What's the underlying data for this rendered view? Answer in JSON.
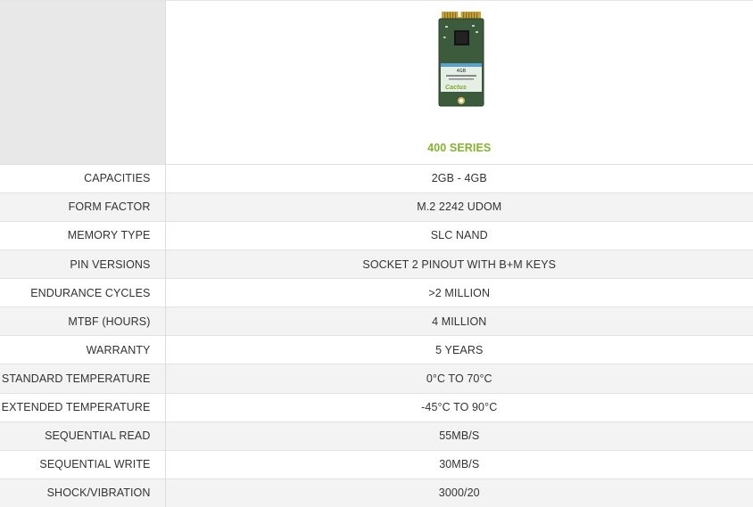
{
  "product": {
    "series_title": "400 SERIES",
    "image_label_capacity": "4GB",
    "image_brand": "Cactus"
  },
  "specs": [
    {
      "label": "CAPACITIES",
      "value": "2GB - 4GB"
    },
    {
      "label": "FORM FACTOR",
      "value": "M.2 2242 UDOM"
    },
    {
      "label": "MEMORY TYPE",
      "value": "SLC NAND"
    },
    {
      "label": "PIN VERSIONS",
      "value": "SOCKET 2 PINOUT WITH B+M KEYS"
    },
    {
      "label": "ENDURANCE CYCLES",
      "value": ">2 MILLION"
    },
    {
      "label": "MTBF (HOURS)",
      "value": "4 MILLION"
    },
    {
      "label": "WARRANTY",
      "value": "5 YEARS"
    },
    {
      "label": "STANDARD TEMPERATURE",
      "value": "0°C TO 70°C"
    },
    {
      "label": "EXTENDED TEMPERATURE",
      "value": "-45°C TO 90°C"
    },
    {
      "label": "SEQUENTIAL READ",
      "value": "55MB/S"
    },
    {
      "label": "SEQUENTIAL WRITE",
      "value": "30MB/S"
    },
    {
      "label": "SHOCK/VIBRATION",
      "value": "3000/20"
    }
  ],
  "colors": {
    "accent": "#86b32d",
    "header_gray": "#e8e8e8",
    "stripe": "#f3f3f3",
    "pcb": "#3c5b3c",
    "gold": "#caa23a"
  }
}
